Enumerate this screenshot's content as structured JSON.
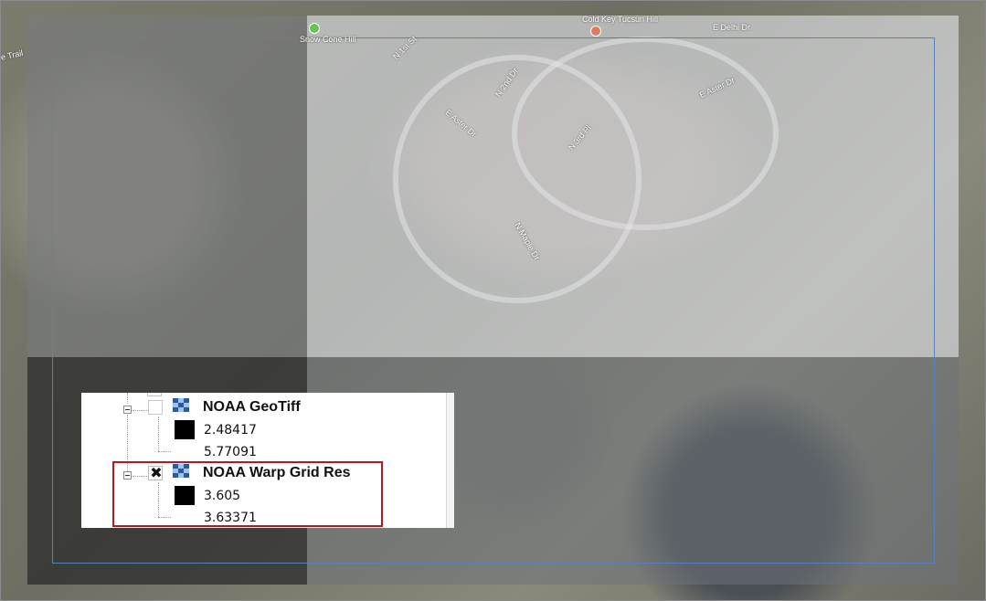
{
  "map": {
    "labels": {
      "snow_cone": "Snow Cone Hill",
      "cold_key": "Cold Key Tucsun Hill",
      "e_delhi": "E Delhi Dr",
      "e_aster_top": "E Aster Dr",
      "e_aster_mid": "E Aster Dr",
      "n_1st": "N 1st St",
      "n_2nd": "N 2nd Dr",
      "n_3rd": "N 3rd Pl",
      "n_maple": "N Maple Dr",
      "trail": "e Trail"
    }
  },
  "legend": {
    "layers": [
      {
        "name": "NOAA GeoTiff",
        "checked": false,
        "values": [
          "2.48417",
          "5.77091"
        ]
      },
      {
        "name": "NOAA Warp Grid Res",
        "checked": true,
        "values": [
          "3.605",
          "3.63371"
        ]
      }
    ],
    "check_mark": "✖"
  },
  "colors": {
    "extent_outline": "#5a7fc0",
    "highlight": "#c0141c"
  }
}
